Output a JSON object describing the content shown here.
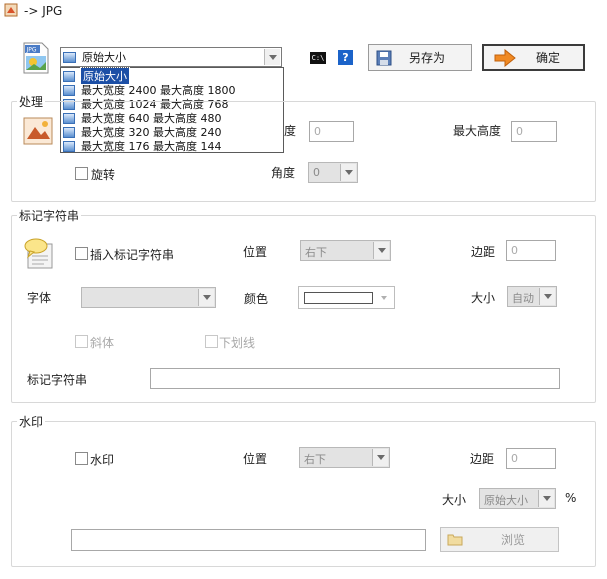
{
  "window": {
    "title": "-> JPG"
  },
  "top": {
    "size_select_value": "原始大小",
    "save_as_label": "另存为",
    "ok_label": "确定",
    "help_label": "?",
    "cmd_label": "C:\\"
  },
  "size_dropdown": {
    "items": [
      "原始大小",
      "最大宽度 2400 最大高度 1800",
      "最大宽度 1024 最大高度 768",
      "最大宽度 640 最大高度 480",
      "最大宽度 320 最大高度 240",
      "最大宽度 176 最大高度 144"
    ]
  },
  "processing": {
    "title": "处理",
    "width_label_tail": "度",
    "width_value": "0",
    "max_height_label": "最大高度",
    "max_height_value": "0",
    "rotate_label": "旋转",
    "angle_label": "角度",
    "angle_value": "0"
  },
  "marker": {
    "title": "标记字符串",
    "insert_label": "插入标记字符串",
    "position_label": "位置",
    "position_value": "右下",
    "margin_label": "边距",
    "margin_value": "0",
    "font_label": "字体",
    "font_value": "",
    "color_label": "颜色",
    "size_label": "大小",
    "size_value": "自动",
    "italic_label": "斜体",
    "underline_label": "下划线",
    "string_label": "标记字符串",
    "string_value": ""
  },
  "watermark": {
    "title": "水印",
    "enable_label": "水印",
    "position_label": "位置",
    "position_value": "右下",
    "margin_label": "边距",
    "margin_value": "0",
    "size_label": "大小",
    "size_value": "原始大小",
    "percent_label": "%",
    "path_value": "",
    "browse_label": "浏览"
  }
}
